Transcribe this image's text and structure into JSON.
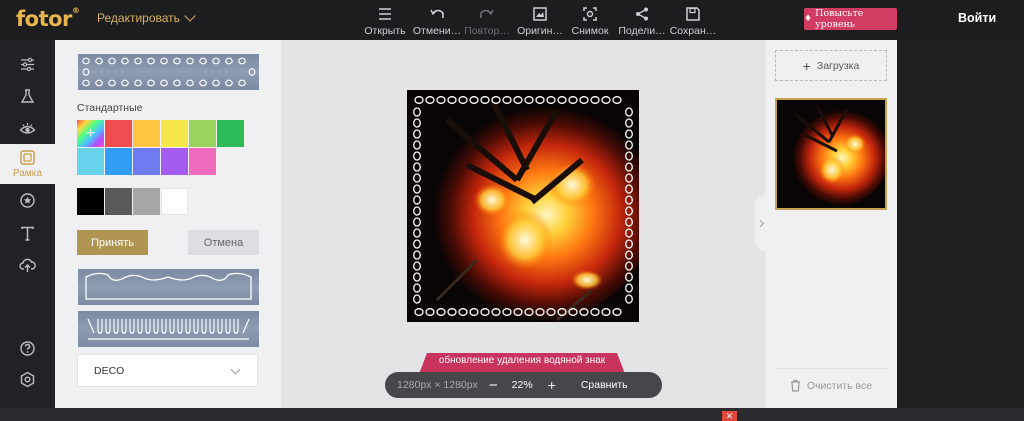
{
  "header": {
    "logo": "fotor",
    "logo_mark": "®",
    "edit_menu_label": "Редактировать",
    "tools": [
      {
        "label": "Открыть",
        "icon": "menu-icon",
        "enabled": true
      },
      {
        "label": "Отмени…",
        "icon": "undo-icon",
        "enabled": true
      },
      {
        "label": "Повтор…",
        "icon": "redo-icon",
        "enabled": false
      },
      {
        "label": "Оригин…",
        "icon": "original-image-icon",
        "enabled": true
      },
      {
        "label": "Снимок",
        "icon": "snapshot-icon",
        "enabled": true
      },
      {
        "label": "Подели…",
        "icon": "share-icon",
        "enabled": true
      },
      {
        "label": "Сохран…",
        "icon": "save-icon",
        "enabled": true
      }
    ],
    "upgrade_label": "Повысьте уровень",
    "login_label": "Войти"
  },
  "rail": {
    "items": [
      {
        "name": "adjust",
        "icon": "sliders-icon"
      },
      {
        "name": "effects",
        "icon": "flask-icon"
      },
      {
        "name": "beauty",
        "icon": "eye-icon"
      },
      {
        "name": "frame",
        "icon": "frame-icon",
        "label": "Рамка",
        "active": true
      },
      {
        "name": "stickers",
        "icon": "star-badge-icon"
      },
      {
        "name": "text",
        "icon": "text-icon"
      },
      {
        "name": "cloud",
        "icon": "cloud-upload-icon"
      },
      {
        "name": "help",
        "icon": "help-icon"
      },
      {
        "name": "settings",
        "icon": "settings-icon"
      }
    ]
  },
  "frame_panel": {
    "section_title": "Стандартные",
    "color_rows": [
      [
        "#rainbow",
        "#ef4d4d",
        "#ffc542",
        "#f5e74a",
        "#9bd35c",
        "#2dbb58"
      ],
      [
        "#67d2ea",
        "#2f9df4",
        "#6e7af0",
        "#a45bf0",
        "#f16bbd"
      ],
      [
        "#000000",
        "#595959",
        "#a6a6a6",
        "#ffffff"
      ]
    ],
    "accept_label": "Принять",
    "cancel_label": "Отмена",
    "category_select": "DECO"
  },
  "canvas": {
    "watermark_banner": "обновление удаления водяной знак",
    "dimensions": "1280px × 1280px",
    "zoom_out": "−",
    "zoom_level": "22%",
    "zoom_in": "+",
    "compare_label": "Сравнить"
  },
  "right_panel": {
    "upload_plus": "+",
    "upload_label": "Загрузка",
    "clear_label": "Очистить все"
  },
  "bottom": {
    "close_symbol": "✕"
  },
  "colors": {
    "accent_gold": "#c7a24e",
    "upgrade_pink": "#d23b62",
    "accept_button": "#b09552"
  }
}
